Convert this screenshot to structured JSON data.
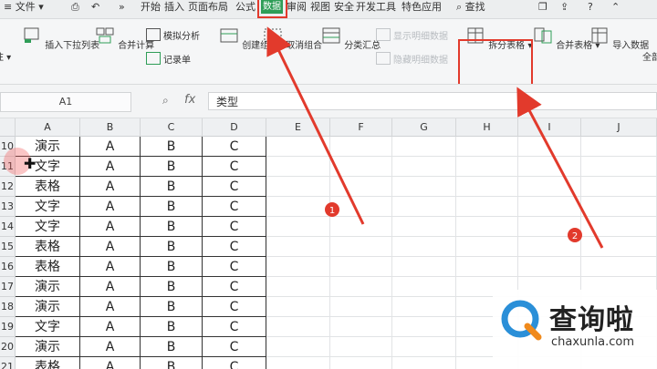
{
  "menubar": {
    "file_label": "文件",
    "tabs": [
      "开始",
      "插入",
      "页面布局",
      "公式",
      "数据",
      "审阅",
      "视图",
      "安全",
      "开发工具",
      "特色应用"
    ],
    "active_tab": "数据",
    "search_label": "查找"
  },
  "ribbon": {
    "insert_dropdown": "插入下拉列表",
    "merge_calc": "合并计算",
    "simulation": "模拟分析",
    "record_form": "记录单",
    "create_group": "创建组",
    "ungroup": "取消组合",
    "subtotal": "分类汇总",
    "show_detail": "显示明细数据",
    "hide_detail": "隐藏明细数据",
    "split_table": "拆分表格",
    "merge_table": "合并表格",
    "import_data": "导入数据",
    "all": "全部"
  },
  "formula_bar": {
    "cell_ref": "A1",
    "fx": "fx",
    "value": "类型"
  },
  "grid": {
    "columns": [
      "A",
      "B",
      "C",
      "D",
      "E",
      "F",
      "G",
      "H",
      "I",
      "J"
    ],
    "rows": [
      {
        "num": "10",
        "a": "演示",
        "b": "A",
        "c": "B",
        "d": "C"
      },
      {
        "num": "11",
        "a": "文字",
        "b": "A",
        "c": "B",
        "d": "C"
      },
      {
        "num": "12",
        "a": "表格",
        "b": "A",
        "c": "B",
        "d": "C"
      },
      {
        "num": "13",
        "a": "文字",
        "b": "A",
        "c": "B",
        "d": "C"
      },
      {
        "num": "14",
        "a": "文字",
        "b": "A",
        "c": "B",
        "d": "C"
      },
      {
        "num": "15",
        "a": "表格",
        "b": "A",
        "c": "B",
        "d": "C"
      },
      {
        "num": "16",
        "a": "表格",
        "b": "A",
        "c": "B",
        "d": "C"
      },
      {
        "num": "17",
        "a": "演示",
        "b": "A",
        "c": "B",
        "d": "C"
      },
      {
        "num": "18",
        "a": "演示",
        "b": "A",
        "c": "B",
        "d": "C"
      },
      {
        "num": "19",
        "a": "文字",
        "b": "A",
        "c": "B",
        "d": "C"
      },
      {
        "num": "20",
        "a": "演示",
        "b": "A",
        "c": "B",
        "d": "C"
      },
      {
        "num": "21",
        "a": "表格",
        "b": "A",
        "c": "B",
        "d": "C"
      }
    ]
  },
  "annotations": {
    "step1": "1",
    "step2": "2",
    "color": "#e23a2c"
  },
  "watermark": {
    "name": "查询啦",
    "url": "chaxunla.com"
  },
  "colors": {
    "accent_green": "#2e9d57",
    "highlight_red": "#e23a2c"
  }
}
